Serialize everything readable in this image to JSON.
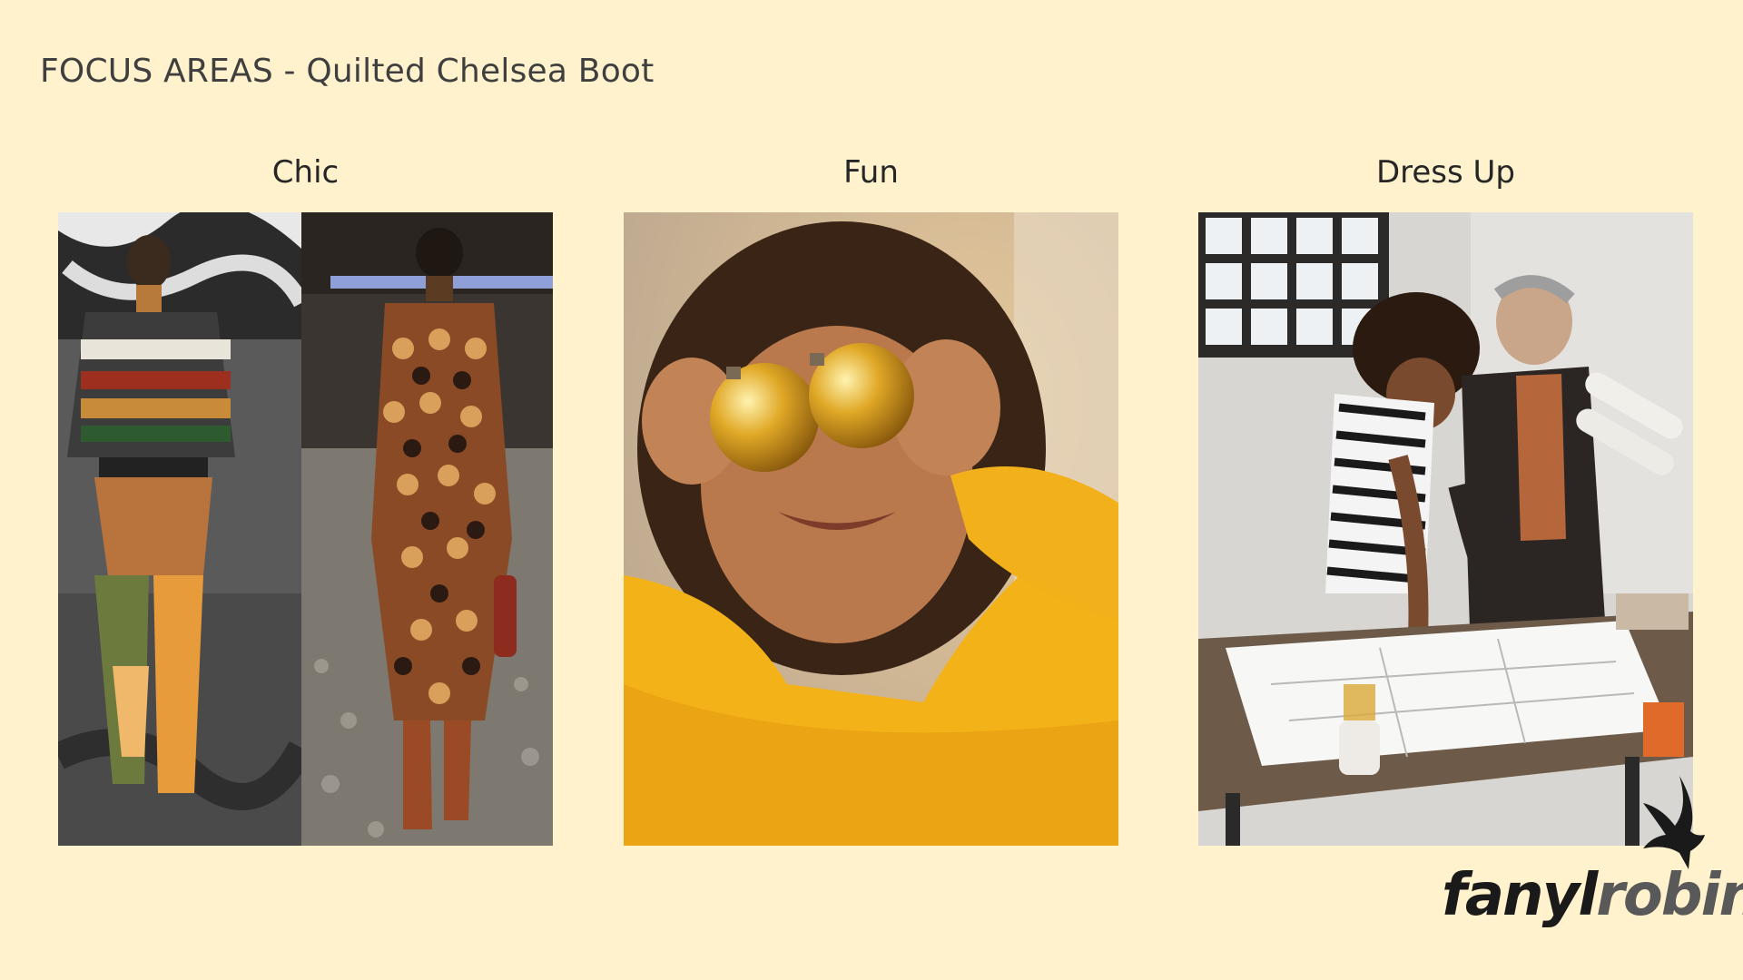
{
  "slide": {
    "title": "FOCUS AREAS - Quilted Chelsea Boot",
    "background": "#FFF2CC"
  },
  "columns": [
    {
      "heading": "Chic",
      "image": "runway-models-photo"
    },
    {
      "heading": "Fun",
      "image": "child-with-gold-ornaments-photo"
    },
    {
      "heading": "Dress Up",
      "image": "architects-at-desk-photo"
    }
  ],
  "logo": {
    "part1": "fanyl",
    "part2": "robin",
    "icon": "bird-icon"
  }
}
